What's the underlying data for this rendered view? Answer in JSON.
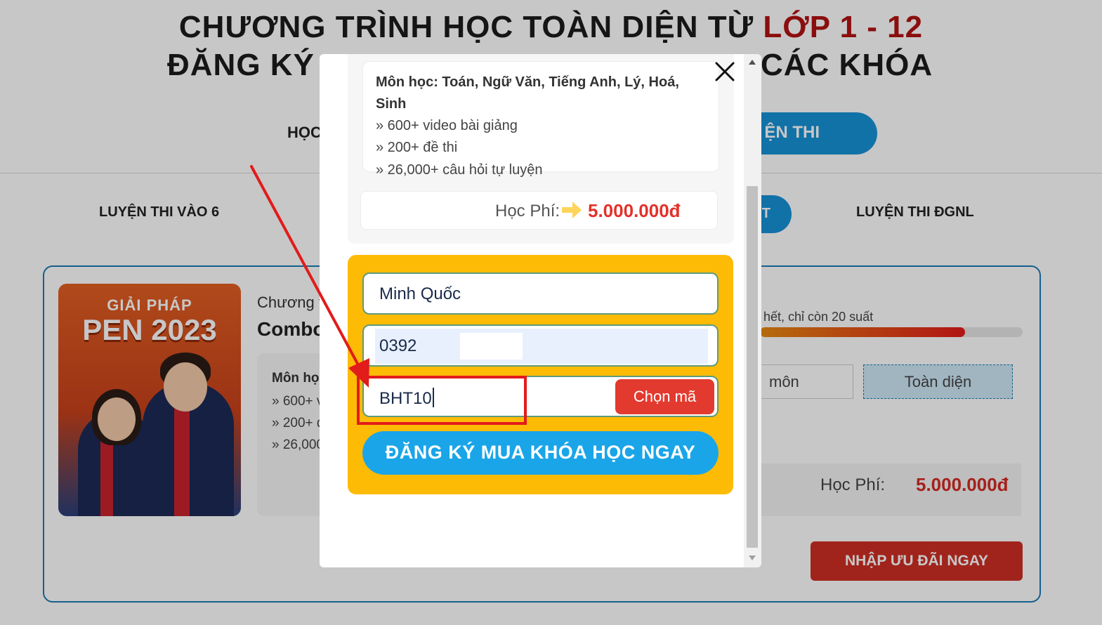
{
  "page": {
    "headline_line1": "CHƯƠNG TRÌNH HỌC TOÀN DIỆN TỪ ",
    "headline_line1_red": "LỚP 1 - 12",
    "headline_line2_left": "ĐĂNG KÝ",
    "headline_line2_right": "CÁC KHÓA",
    "top_nav_left": "HỌC",
    "top_nav_active": "ỆN THI",
    "sub_tab_left": "LUYỆN THI VÀO 6",
    "sub_tab_active": "T",
    "sub_tab_right": "LUYỆN THI ĐGNL"
  },
  "card": {
    "poster_line1": "GIẢI PHÁP",
    "poster_line2": "PEN 2023",
    "subtitle": "Chương t",
    "title": "Combo",
    "subjects_prefix": "Môn họ",
    "line1": "» 600+ v",
    "line2": "» 200+ đ",
    "line3": "» 26,000",
    "stock_text": "hết, chỉ còn 20 suất",
    "stock_progress": 0.78,
    "option_a": "môn",
    "option_b": "Toàn diện",
    "fee_label": "Học Phí:",
    "fee_value": "5.000.000đ",
    "promo_button": "NHẬP ƯU ĐÃI NGAY"
  },
  "modal": {
    "subjects_line1": "Môn học: Toán, Ngữ Văn, Tiếng Anh, Lý, Hoá,",
    "subjects_line2": "Sinh",
    "feature1": "» 600+ video bài giảng",
    "feature2": "» 200+ đề thi",
    "feature3": "» 26,000+ câu hỏi tự luyện",
    "fee_label": "Học Phí:",
    "fee_value": "5.000.000đ",
    "name_value": "Minh Quốc",
    "phone_value": "0392",
    "code_value": "BHT10",
    "pick_code_button": "Chọn mã",
    "submit_button": "ĐĂNG KÝ MUA KHÓA HỌC NGAY"
  },
  "colors": {
    "form_panel": "#fdbb06",
    "submit_button": "#1aa5e9",
    "pick_button": "#e33a2f",
    "fee_red": "#e3312a",
    "annotation_red": "#e21b1b",
    "brand_blue": "#1793d6"
  }
}
